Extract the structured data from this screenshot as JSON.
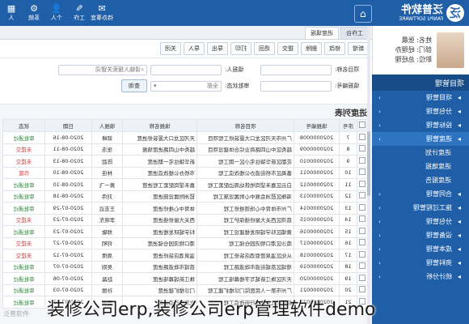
{
  "header": {
    "logo_cn": "泛普软件",
    "logo_en": "FANPU SOFTWARE",
    "logo_mark": "泛",
    "home_glyph": "⌂",
    "icons": [
      {
        "glyph": "✉",
        "label": "待办事宜"
      },
      {
        "glyph": "✎",
        "label": "工作"
      },
      {
        "glyph": "👤",
        "label": "个人"
      },
      {
        "glyph": "⚙",
        "label": "系统"
      },
      {
        "glyph": "▦",
        "label": "人"
      }
    ]
  },
  "user": {
    "name_line": "姓名: 张晨",
    "dept_line": "部门: 经理办",
    "role_line": "职位: 总经理"
  },
  "sidebar": {
    "header": "项目管理",
    "items": [
      {
        "icon": "▸",
        "label": "项目管理"
      },
      {
        "icon": "▸",
        "label": "分包管理"
      },
      {
        "icon": "▸",
        "label": "投标管理"
      },
      {
        "icon": "▸",
        "label": "进度管理"
      },
      {
        "icon": "▸",
        "label": "合同管理"
      },
      {
        "icon": "▸",
        "label": "施工过程管理"
      },
      {
        "icon": "▸",
        "label": "分包管理"
      },
      {
        "icon": "▸",
        "label": "设备管理"
      },
      {
        "icon": "▸",
        "label": "成本管理"
      },
      {
        "icon": "▸",
        "label": "资料管理"
      },
      {
        "icon": "▸",
        "label": "统计分析"
      }
    ],
    "sub_items": [
      "进度计划",
      "进度填报",
      "进度报告"
    ]
  },
  "tabs": [
    "工作台",
    "进度填报"
  ],
  "toolbar": [
    "新增",
    "修改",
    "删除",
    "提交",
    "退回",
    "打印",
    "导出",
    "导入",
    "关闭"
  ],
  "filters": {
    "project_label": "项目名称:",
    "project_placeholder": "",
    "person_label": "填报人:",
    "person_placeholder": "",
    "search_placeholder": "请输入搜索关键词",
    "number_label": "填报编号:",
    "status_label": "审批状态:",
    "status_value": "全部",
    "query_label": "查询"
  },
  "list": {
    "title": "进度列表",
    "columns": [
      "",
      "序号",
      "填报编号",
      "项目名称",
      "填报名称",
      "填报人",
      "日期",
      "状态"
    ],
    "rows": [
      {
        "no": "7",
        "code": "2020000008",
        "project": "广州市天河区龙口大厦装修工程项目",
        "name": "天河区龙口大厦装修进度",
        "person": "郭峰",
        "date": "2020-08-16",
        "status": "审批通过"
      },
      {
        "no": "8",
        "code": "2020000009",
        "project": "越秀区中山四路商业综合体建设项目",
        "name": "越秀中山四路进度填报",
        "person": "张浩",
        "date": "2020-08-11",
        "status": "未提交"
      },
      {
        "no": "9",
        "code": "2020000010",
        "project": "花都区新华镇住宅小区一期工程",
        "name": "新华镇住宅一期进度",
        "person": "陈超",
        "date": "2020-08-13",
        "status": "未提交"
      },
      {
        "no": "10",
        "code": "2020000011",
        "project": "番禺区市桥街道办公楼改造工程",
        "name": "市桥办公楼改造进度",
        "person": "林佳",
        "date": "2020-08-10",
        "status": "作废"
      },
      {
        "no": "11",
        "code": "2020000012",
        "project": "白云区嘉禾望岗地铁站周边配套工程",
        "name": "嘉禾望岗配套工程进度",
        "person": "黄一飞",
        "date": "2020-08-10",
        "status": "审批通过"
      },
      {
        "no": "12",
        "code": "2020000013",
        "project": "海珠区琶洲会展中心附属设施工程",
        "name": "琶洲附属设施进度",
        "person": "刘伟",
        "date": "2020-08-18",
        "status": "审批通过"
      },
      {
        "no": "13",
        "code": "2020000014",
        "project": "广州市体育中心场馆维修工程",
        "name": "体育中心维修进度",
        "person": "王志远",
        "date": "2020-07-29",
        "status": "审批通过"
      },
      {
        "no": "14",
        "code": "2020000015",
        "project": "荔湾区西关大屋修缮保护工程",
        "name": "西关大屋修缮进度",
        "person": "李晓东",
        "date": "2020-07-23",
        "status": "未提交"
      },
      {
        "no": "15",
        "code": "2020000016",
        "project": "黄埔区科学城研发楼建设工程",
        "name": "科学城研发楼进度",
        "person": "郑敏",
        "date": "2020-07-23",
        "status": "审批通过"
      },
      {
        "no": "16",
        "code": "2020000017",
        "project": "南沙区港口物流园仓储工程",
        "name": "港口物流园仓储进度",
        "person": "何明",
        "date": "2020-07-27",
        "status": "未提交"
      },
      {
        "no": "17",
        "code": "2020000018",
        "project": "从化区温泉度假酒店装修工程",
        "name": "温泉酒店装修进度",
        "person": "周倩",
        "date": "2020-07-12",
        "status": "未提交"
      },
      {
        "no": "18",
        "code": "2020000019",
        "project": "增城区荔城街道市政道路工程",
        "name": "荔城市政道路进度",
        "person": "吴刚",
        "date": "2020-07-07",
        "status": "审批通过"
      },
      {
        "no": "19",
        "code": "2020000020",
        "project": "天河区珠江新城写字楼幕墙工程",
        "name": "珠江新城幕墙进度",
        "person": "赵磊",
        "date": "2020-07-06",
        "status": "审批通过"
      },
      {
        "no": "20",
        "code": "2020000021",
        "project": "广州市第一人民医院门诊楼扩建工程",
        "name": "门诊楼扩建进度",
        "person": "孙丽",
        "date": "2020-07-03",
        "status": "审批通过"
      },
      {
        "no": "21",
        "code": "2020000022",
        "project": "越秀区北京路步行街改造工程",
        "name": "北京路改造进度",
        "person": "马俊",
        "date": "2020-07-03",
        "status": "审批通过"
      }
    ]
  },
  "overlay": {
    "caption": "装修公司erp,装修公司erp管理软件demo",
    "watermark": "泛普软件"
  },
  "colors": {
    "primary": "#1f5fa8",
    "approved": "#2a8a3a",
    "pending": "#d23b3b"
  }
}
